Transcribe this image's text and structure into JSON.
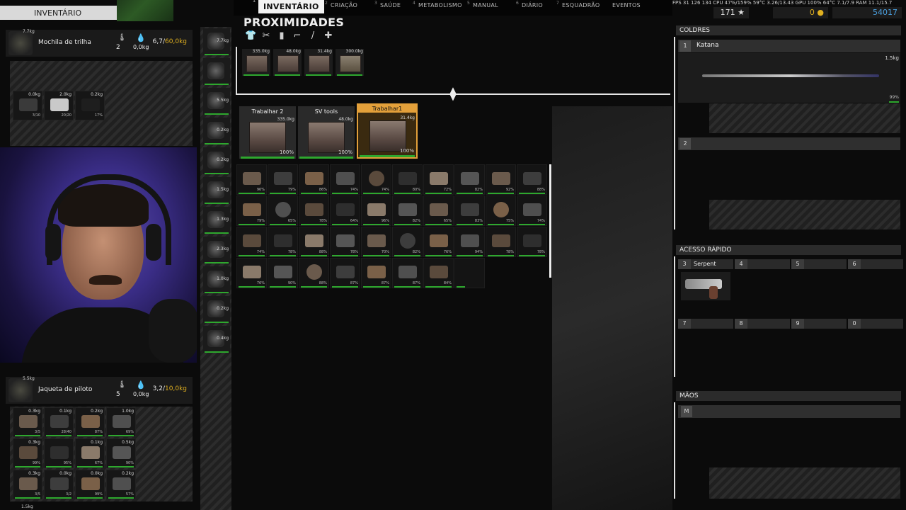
{
  "header": {
    "inventory_title": "INVENTÁRIO",
    "tabs": [
      {
        "num": "1",
        "label": "INVENTÁRIO"
      },
      {
        "num": "2",
        "label": "CRIAÇÃO"
      },
      {
        "num": "3",
        "label": "SAÚDE"
      },
      {
        "num": "4",
        "label": "METABOLISMO"
      },
      {
        "num": "5",
        "label": "MANUAL"
      },
      {
        "num": "6",
        "label": "DIÁRIO"
      },
      {
        "num": "7",
        "label": "ESQUADRÃO"
      },
      {
        "num": "",
        "label": "EVENTOS"
      }
    ]
  },
  "stats": {
    "overlay": "FPS 31  126 134        CPU 47%/159%  59°C  3.26/13.43  GPU 100% 64°C  7.1/7.9  RAM 11.1/15.7",
    "fame": "171 ★",
    "gold": "0",
    "money": "54017"
  },
  "backpack": {
    "info": "7.7kg",
    "pct": "99%",
    "name": "Mochila de trilha",
    "count": "2",
    "weight": "0,0kg",
    "capacity": "6,7/",
    "capacity_max": "60,0kg",
    "slots": [
      {
        "wt": "0.0kg",
        "pct": "3/10"
      },
      {
        "wt": "2.0kg",
        "pct": "20/20"
      },
      {
        "wt": "0.2kg",
        "pct": "17%"
      }
    ]
  },
  "jacket": {
    "info": "5.5kg",
    "pct": "100%",
    "name": "Jaqueta de piloto",
    "count": "5",
    "weight": "0,0kg",
    "capacity": "3,2/",
    "capacity_max": "10,0kg",
    "slots": [
      {
        "wt": "0.3kg",
        "pct": "3/5"
      },
      {
        "wt": "0.1kg",
        "pct": "28/40"
      },
      {
        "wt": "0.2kg",
        "pct": "87%"
      },
      {
        "wt": "1.0kg",
        "pct": "69%"
      },
      {
        "wt": "0.3kg",
        "pct": "99%"
      },
      {
        "wt": "",
        "pct": "95%"
      },
      {
        "wt": "0.1kg",
        "pct": "67%"
      },
      {
        "wt": "0.5kg",
        "pct": "90%"
      },
      {
        "wt": "0.3kg",
        "pct": "3/5"
      },
      {
        "wt": "0.0kg",
        "pct": "3/2"
      },
      {
        "wt": "0.0kg",
        "pct": "99%"
      },
      {
        "wt": "0.2kg",
        "pct": "57%"
      }
    ],
    "footer_wt": "1.5kg"
  },
  "equipment": [
    "7.7kg",
    "",
    "5.5kg",
    "0.2kg",
    "0.2kg",
    "1.5kg",
    "1.3kg",
    "2.3kg",
    "1.0kg",
    "0.2kg",
    "0.4kg"
  ],
  "proximity": {
    "title": "PROXIMIDADES",
    "crates": [
      {
        "wt": "335.0kg"
      },
      {
        "wt": "48.0kg"
      },
      {
        "wt": "31.4kg"
      },
      {
        "wt": "300.0kg"
      }
    ],
    "containers": [
      {
        "label": "Trabalhar 2",
        "wt": "335.0kg",
        "pct": "100%"
      },
      {
        "label": "SV tools",
        "wt": "48.0kg",
        "pct": "100%"
      },
      {
        "label": "Trabalhar1",
        "wt": "31.4kg",
        "pct": "100%"
      }
    ],
    "items": [
      "96%",
      "79%",
      "86%",
      "74%",
      "74%",
      "80%",
      "72%",
      "82%",
      "92%",
      "88%",
      "79%",
      "65%",
      "78%",
      "64%",
      "96%",
      "82%",
      "65%",
      "83%",
      "75%",
      "74%",
      "74%",
      "78%",
      "88%",
      "78%",
      "70%",
      "82%",
      "76%",
      "94%",
      "78%",
      "78%",
      "76%",
      "90%",
      "88%",
      "87%",
      "87%",
      "87%",
      "84%",
      "",
      "",
      ""
    ]
  },
  "holsters": {
    "title": "COLDRES",
    "slot1_num": "1",
    "slot1_label": "Katana",
    "slot1_wt": "1.5kg",
    "slot1_pct": "99%",
    "slot2_num": "2"
  },
  "quick": {
    "title": "ACESSO RÁPIDO",
    "slots": [
      {
        "num": "3",
        "label": "Serpent"
      },
      {
        "num": "4",
        "label": ""
      },
      {
        "num": "5",
        "label": ""
      },
      {
        "num": "6",
        "label": ""
      },
      {
        "num": "7",
        "label": ""
      },
      {
        "num": "8",
        "label": ""
      },
      {
        "num": "9",
        "label": ""
      },
      {
        "num": "0",
        "label": ""
      }
    ]
  },
  "hands": {
    "title": "MÃOS",
    "slot_num": "M"
  },
  "colors": {
    "accent": "#e3a03a",
    "durability": "#2ea82e",
    "capacity_max": "#e0b020"
  }
}
